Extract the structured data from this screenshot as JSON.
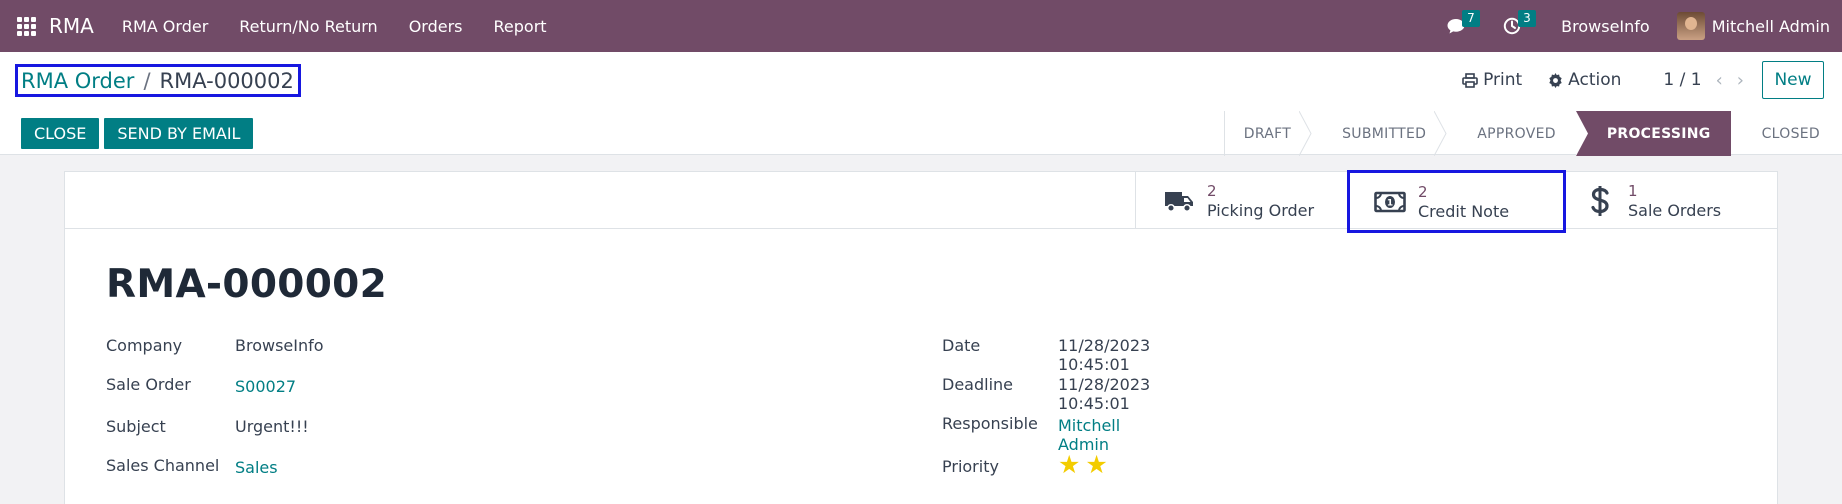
{
  "navbar": {
    "brand": "RMA",
    "menu": [
      "RMA Order",
      "Return/No Return",
      "Orders",
      "Report"
    ],
    "messages_count": "7",
    "activities_count": "3",
    "company": "BrowseInfo",
    "user": "Mitchell Admin"
  },
  "breadcrumb": {
    "parent": "RMA Order",
    "separator": "/",
    "current": "RMA-000002"
  },
  "toolbar": {
    "print_label": "Print",
    "action_label": "Action",
    "pager": "1 / 1",
    "new_label": "New"
  },
  "actions": {
    "close_label": "CLOSE",
    "send_email_label": "SEND BY EMAIL"
  },
  "statusbar": {
    "stages": [
      "DRAFT",
      "SUBMITTED",
      "APPROVED",
      "PROCESSING",
      "CLOSED"
    ],
    "active": "PROCESSING"
  },
  "smart_buttons": [
    {
      "value": "2",
      "label": "Picking Order",
      "icon": "truck-icon"
    },
    {
      "value": "2",
      "label": "Credit Note",
      "icon": "money-bill-icon"
    },
    {
      "value": "1",
      "label": "Sale Orders",
      "icon": "dollar-icon"
    }
  ],
  "record": {
    "title": "RMA-000002",
    "left_fields": [
      {
        "label": "Company",
        "value": "BrowseInfo"
      },
      {
        "label": "Sale Order",
        "value": "S00027"
      },
      {
        "label": "Subject",
        "value": "Urgent!!!"
      },
      {
        "label": "Sales Channel",
        "value": "Sales"
      }
    ],
    "right_fields": [
      {
        "label": "Date",
        "value": "11/28/2023 10:45:01"
      },
      {
        "label": "Deadline",
        "value": "11/28/2023 10:45:01"
      },
      {
        "label": "Responsible",
        "value": "Mitchell Admin"
      },
      {
        "label": "Priority",
        "value": "2"
      }
    ]
  },
  "colors": {
    "brand": "#714b67",
    "accent": "#017e84",
    "highlight_box": "#1717e0",
    "star": "#f3cc00"
  }
}
